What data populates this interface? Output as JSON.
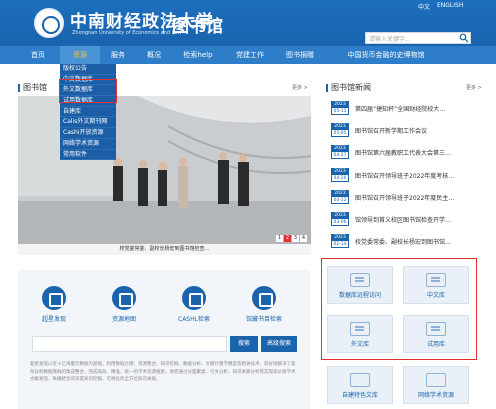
{
  "header": {
    "school_cn": "中南财经政法大学",
    "school_en": "Zhongnan University of Economics and Law",
    "site_title": "图书馆",
    "lang_zh": "中文",
    "lang_en": "ENGLISH",
    "search_placeholder": "请输入关键字..."
  },
  "nav": {
    "items": [
      {
        "label": "首页"
      },
      {
        "label": "资源"
      },
      {
        "label": "服务"
      },
      {
        "label": "概况"
      },
      {
        "label": "检索help"
      },
      {
        "label": "党建工作"
      },
      {
        "label": "图书捐赠"
      },
      {
        "label": "中国货币金融的史博物馆"
      }
    ],
    "active_color": "#f5c242"
  },
  "dropdown": {
    "items": [
      {
        "label": "版权公告"
      },
      {
        "label": "中文数据库"
      },
      {
        "label": "外文数据库"
      },
      {
        "label": "试用数据库"
      },
      {
        "label": "自建库"
      },
      {
        "label": "Calis外文期刊网"
      },
      {
        "label": "Cashi开放资源"
      },
      {
        "label": "网络学术资源"
      },
      {
        "label": "常用软件"
      }
    ]
  },
  "photo_section": {
    "title": "图书馆",
    "more": "更多 >",
    "caption": "校党委常委、副校长杨宏到图书馆检查…",
    "pages": [
      "1",
      "2",
      "3",
      "4"
    ],
    "active_page": "2"
  },
  "news_section": {
    "title": "图书馆新闻",
    "more": "更多 >",
    "items": [
      {
        "year": "2023",
        "md": "05-11",
        "title": "第四届“捷知杯”全国财经院校大…"
      },
      {
        "year": "2023",
        "md": "05-05",
        "title": "图书馆召开新学期工作会议"
      },
      {
        "year": "2023",
        "md": "04-27",
        "title": "图书馆第六届教职工代表大会第三…"
      },
      {
        "year": "2023",
        "md": "04-20",
        "title": "图书馆召开领导班子2022年度考核…"
      },
      {
        "year": "2023",
        "md": "04-12",
        "title": "图书馆召开领导班子2022年度民主…"
      },
      {
        "year": "2023",
        "md": "03-06",
        "title": "馆领导到首义校区图书馆检查开学…"
      },
      {
        "year": "2023",
        "md": "02-14",
        "title": "校党委常委、副校长杨宏到图书馆…"
      }
    ]
  },
  "search_panel": {
    "tools": [
      {
        "label": "超星发现",
        "icon": "discovery-icon"
      },
      {
        "label": "资源地图",
        "icon": "map-icon"
      },
      {
        "label": "CASHL检索",
        "icon": "cashl-icon"
      },
      {
        "label": "馆藏书目检索",
        "icon": "catalog-icon"
      }
    ],
    "search_button": "搜索",
    "advanced_button": "高级搜索",
    "description": "超星发现以近十亿海量元数据为基础，利用数据仓储、资源整合、知识挖掘、数据分析、文献计量学模型等相关技术，较好地解决了复杂异构数据库群的集成整合，完成高效、精准、统一的学术资源搜索，进而通过分面聚类、引文分析、知识关联分析等实现高价值学术文献发现、纵横结合的深度知识挖掘、可视化的全方位知识关联。"
  },
  "quick_links": [
    {
      "label": "数据库远程访问",
      "icon": "remote-access-icon"
    },
    {
      "label": "中文库",
      "icon": "chinese-db-icon"
    },
    {
      "label": "外文库",
      "icon": "foreign-db-icon"
    },
    {
      "label": "试用库",
      "icon": "trial-db-icon"
    },
    {
      "label": "自建特色文库",
      "icon": "self-built-icon"
    },
    {
      "label": "网络学术资源",
      "icon": "web-resource-icon"
    }
  ],
  "colors": {
    "primary": "#1a63ad",
    "nav": "#2d7dc8",
    "highlight": "#e63030"
  }
}
